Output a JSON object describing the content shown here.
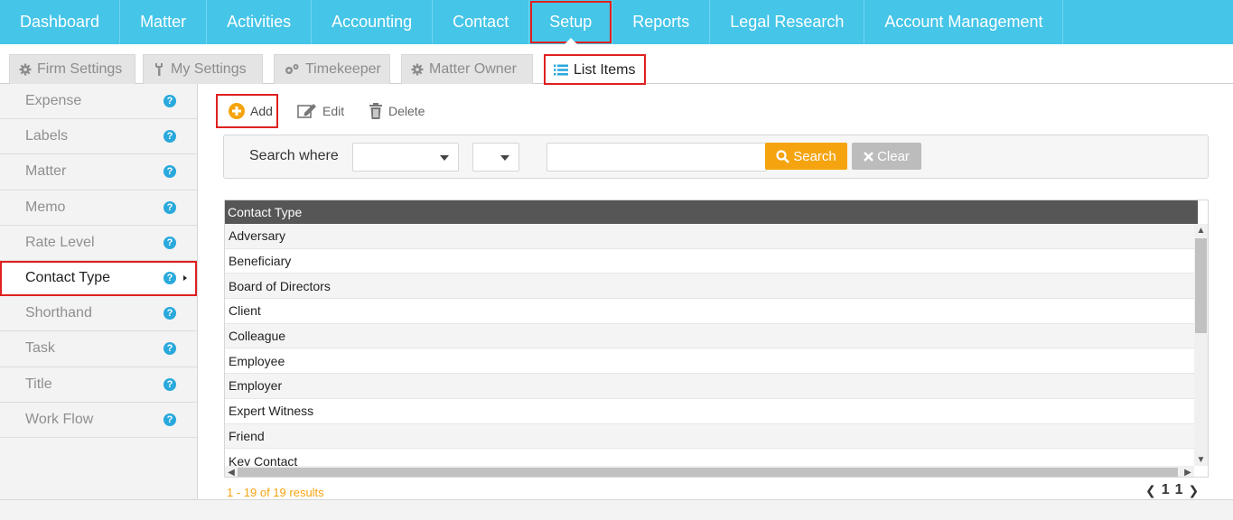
{
  "topnav": {
    "items": [
      "Dashboard",
      "Matter",
      "Activities",
      "Accounting",
      "Contact",
      "Setup",
      "Reports",
      "Legal Research",
      "Account Management"
    ],
    "active": "Setup"
  },
  "subtabs": {
    "items": [
      {
        "label": "Firm Settings",
        "icon": "gear-icon"
      },
      {
        "label": "My Settings",
        "icon": "wrench-icon"
      },
      {
        "label": "Timekeeper",
        "icon": "cogs-icon"
      },
      {
        "label": "Matter Owner",
        "icon": "gear-icon"
      },
      {
        "label": "List Items",
        "icon": "list-icon"
      }
    ],
    "active": "List Items"
  },
  "sidebar": {
    "items": [
      "Expense",
      "Labels",
      "Matter",
      "Memo",
      "Rate Level",
      "Contact Type",
      "Shorthand",
      "Task",
      "Title",
      "Work Flow"
    ],
    "active": "Contact Type",
    "help_glyph": "?"
  },
  "toolbar": {
    "add_label": "Add",
    "edit_label": "Edit",
    "delete_label": "Delete"
  },
  "search": {
    "label": "Search where",
    "field_value": "",
    "operator_value": "",
    "query_value": "",
    "search_label": "Search",
    "clear_label": "Clear"
  },
  "grid": {
    "column": "Contact Type",
    "rows": [
      "Adversary",
      "Beneficiary",
      "Board of Directors",
      "Client",
      "Colleague",
      "Employee",
      "Employer",
      "Expert Witness",
      "Friend",
      "Key Contact"
    ]
  },
  "pager": {
    "results_text": "1 - 19 of 19 results",
    "current_page": "1",
    "total_pages": "1"
  },
  "colors": {
    "nav_bg": "#45c5e8",
    "accent_orange": "#f5a40f",
    "highlight_red": "#e02020",
    "help_blue": "#29a9dc"
  }
}
